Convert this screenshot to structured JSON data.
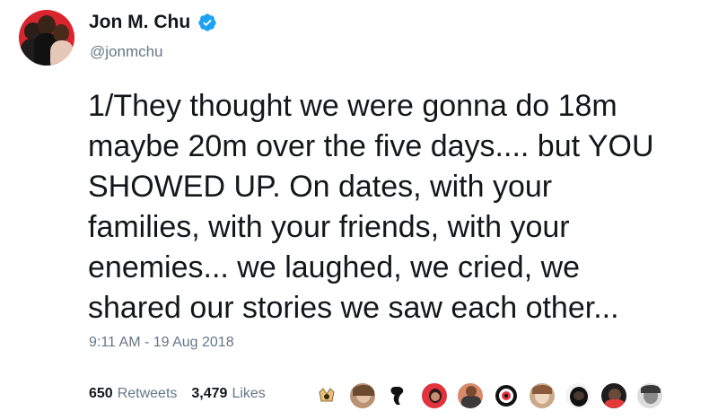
{
  "author": {
    "display_name": "Jon M. Chu",
    "handle": "@jonmchu",
    "verified": true
  },
  "tweet": {
    "lines": [
      "1/They thought we were gonna do 18m",
      "maybe 20m over the five days.... but YOU",
      "SHOWED UP. On dates, with your",
      "families, with your friends, with your",
      "enemies... we laughed, we cried, we",
      "shared our stories we saw each other..."
    ],
    "timestamp": "9:11 AM - 19 Aug 2018"
  },
  "stats": {
    "retweets_count": "650",
    "retweets_label": "Retweets",
    "likes_count": "3,479",
    "likes_label": "Likes"
  },
  "colors": {
    "text": "#14171a",
    "secondary": "#657786",
    "verified_badge": "#1da1f2",
    "avatar_background": "#d9252e"
  },
  "likers": [
    "liker-avatar-1",
    "liker-avatar-2",
    "liker-avatar-3",
    "liker-avatar-4",
    "liker-avatar-5",
    "liker-avatar-6",
    "liker-avatar-7",
    "liker-avatar-8",
    "liker-avatar-9",
    "liker-avatar-10"
  ]
}
